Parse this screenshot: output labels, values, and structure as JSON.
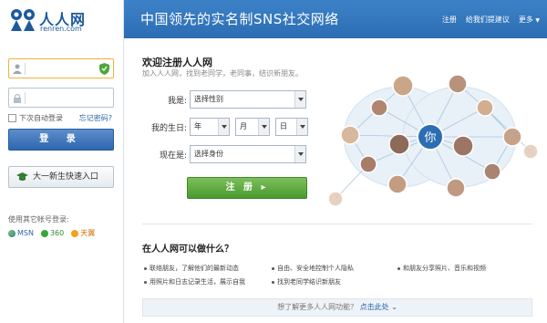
{
  "brand": {
    "name_cn": "人人网",
    "name_en": "renren.com"
  },
  "header": {
    "slogan": "中国领先的实名制SNS社交网络",
    "links": {
      "register": "注册",
      "feedback": "给我们提建议",
      "more": "更多"
    }
  },
  "login": {
    "remember_label": "下次自动登录",
    "forgot_label": "忘记密码?",
    "login_button": "登  录",
    "freshman_button": "大一新生快速入口",
    "other_accounts_label": "使用其它帐号登录:",
    "providers": [
      "MSN",
      "360",
      "天翼"
    ]
  },
  "register": {
    "title": "欢迎注册人人网",
    "subtitle": "加入人人网，找到老同学，老同事，结识新朋友。",
    "gender_label": "我是:",
    "gender_value": "选择性别",
    "birthday_label": "我的生日:",
    "birthday_year": "年",
    "birthday_month": "月",
    "birthday_day": "日",
    "status_label": "现在是:",
    "status_value": "选择身份",
    "submit_button": "注 册"
  },
  "network_center_label": "你",
  "features": {
    "title": "在人人网可以做什么？",
    "items": [
      "联络朋友，了解他们的最新动态",
      "自由、安全地控制个人隐私",
      "和朋友分享照片、音乐和视频",
      "用照片和日志记录生活，展示自我",
      "找到老同学结识新朋友"
    ],
    "more_prefix": "想了解更多人人网功能？",
    "more_link": "点击此处"
  },
  "colors": {
    "brand_blue": "#2c6db3",
    "register_green": "#4a9a2e",
    "accent_link": "#2a65a8"
  }
}
